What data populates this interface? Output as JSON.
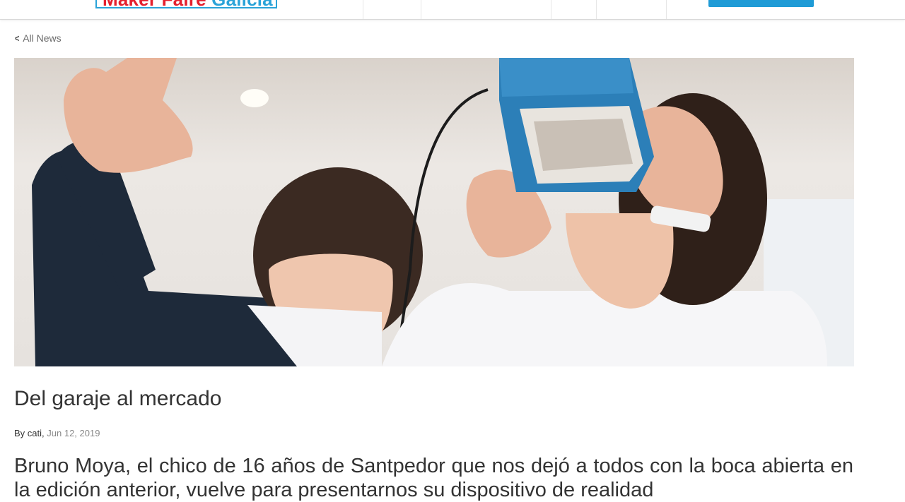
{
  "header": {
    "logo_word1": "Maker Faire",
    "logo_word2": "Galicia"
  },
  "nav": {
    "back_label": "All News"
  },
  "hero": {
    "alt": "Dos jóvenes, uno con un visor de realidad virtual de cartón azul"
  },
  "article": {
    "title": "Del garaje al mercado",
    "by_prefix": "By",
    "author": "cati",
    "date": "Jun 12, 2019",
    "lead": "Bruno Moya, el chico de 16 años de Santpedor que nos dejó a todos con la boca abierta en la edición anterior, vuelve para presentarnos su dispositivo de realidad"
  },
  "colors": {
    "brand_red": "#e4202e",
    "brand_blue": "#2aa3d8",
    "cta_blue": "#1f9bd6",
    "text": "#333333",
    "muted": "#888888"
  }
}
